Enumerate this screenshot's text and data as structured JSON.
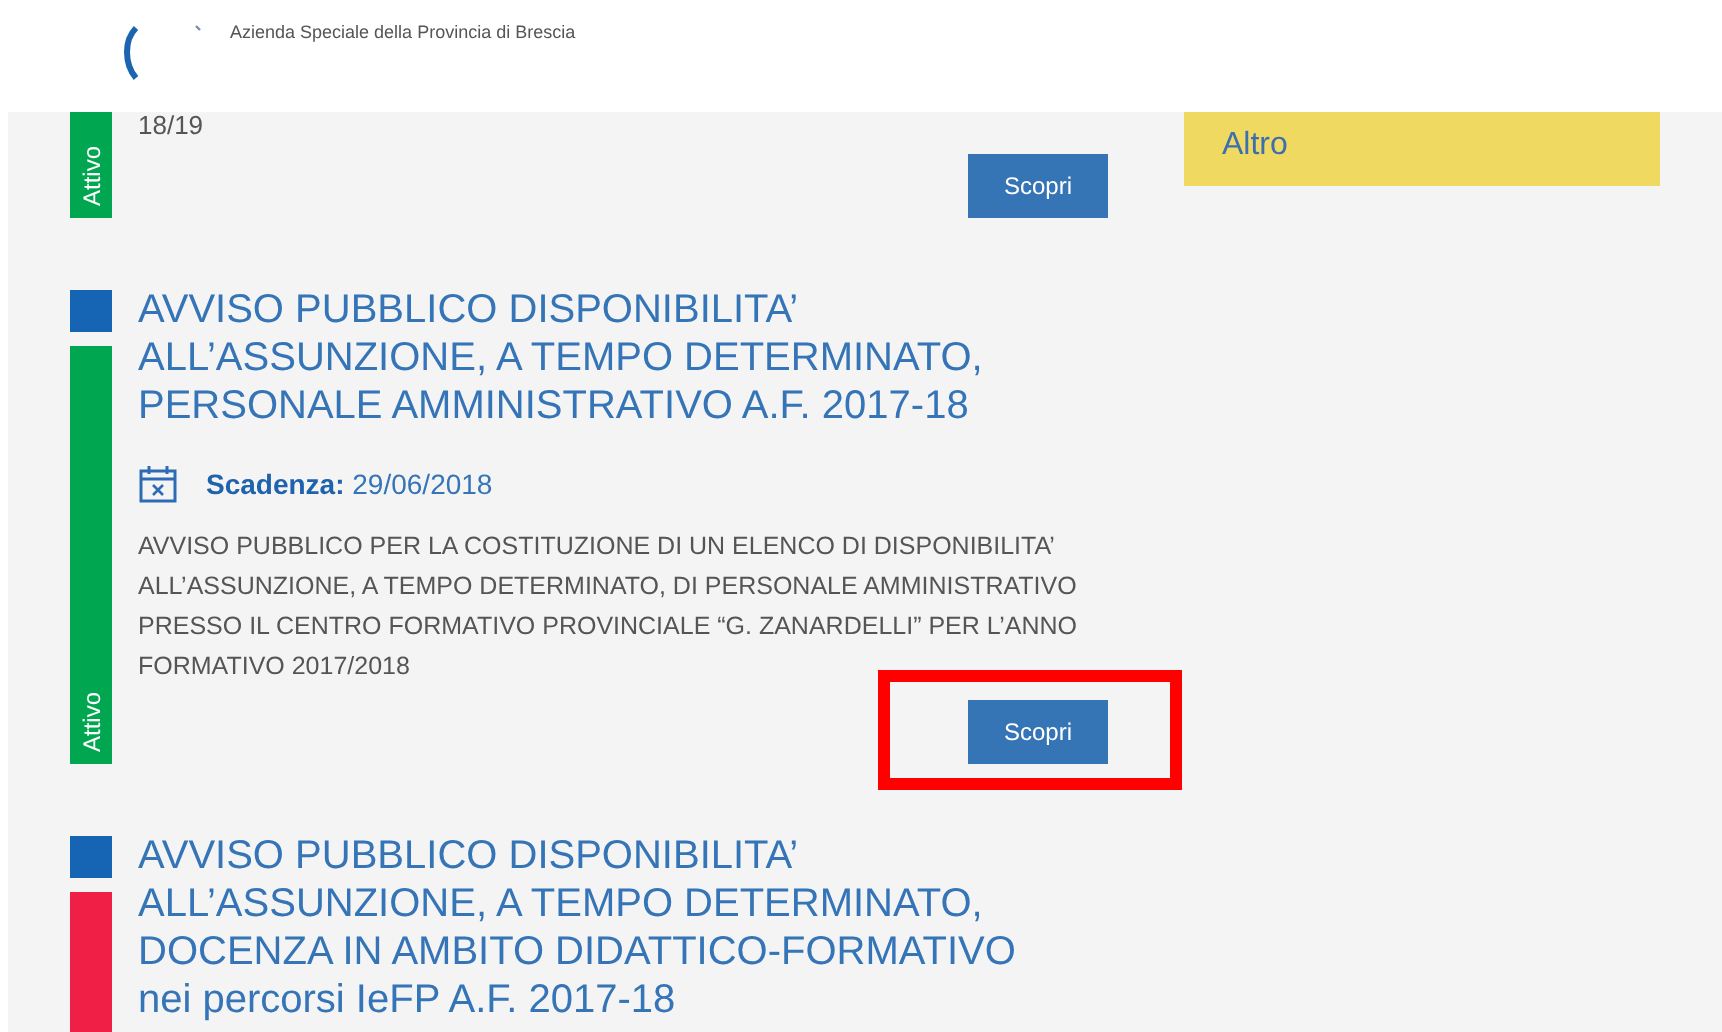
{
  "header": {
    "org_name": "Azienda Speciale della Provincia di Brescia"
  },
  "items": [
    {
      "kind": "partial",
      "tail_text": "18/19",
      "status": {
        "label": "Attivo",
        "color": "#00a650"
      },
      "button": "Scopri"
    },
    {
      "kind": "full",
      "title": "AVVISO PUBBLICO DISPONIBILITA’ ALL’ASSUNZIONE, A TEMPO DETERMINATO, PERSONALE AMMINISTRATIVO A.F. 2017-18",
      "deadline_label": "Scadenza:",
      "deadline": "29/06/2018",
      "description": "AVVISO PUBBLICO PER LA COSTITUZIONE DI UN  ELENCO DI DISPONIBILITA’ ALL’ASSUNZIONE, A TEMPO DETERMINATO,  DI PERSONALE AMMINISTRATIVO PRESSO IL CENTRO FORMATIVO PROVINCIALE “G. ZANARDELLI” PER L’ANNO FORMATIVO 2017/2018",
      "status": {
        "label": "Attivo",
        "color": "#00a650"
      },
      "button": "Scopri",
      "highlighted": true
    },
    {
      "kind": "cut",
      "title": "AVVISO PUBBLICO DISPONIBILITA’ ALL’ASSUNZIONE, A TEMPO DETERMINATO, DOCENZA IN AMBITO DIDATTICO-FORMATIVO nei percorsi IeFP A.F. 2017-18",
      "status": {
        "color": "#ef1f45"
      }
    }
  ],
  "sidebar": {
    "items": [
      {
        "label": "Altro"
      }
    ]
  }
}
